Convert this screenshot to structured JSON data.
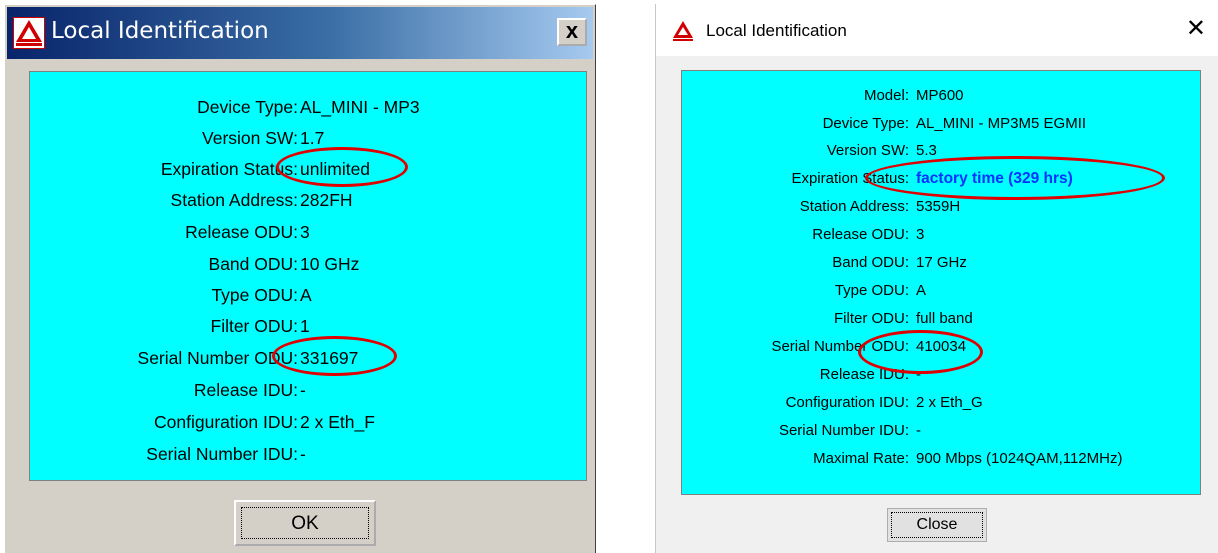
{
  "dialog_classic": {
    "title": "Local Identification",
    "close_glyph": "x",
    "ok_label": "OK",
    "rows": [
      {
        "label": "Device Type:",
        "value": "AL_MINI - MP3"
      },
      {
        "label": "Version SW:",
        "value": "1.7"
      },
      {
        "label": "Expiration Status:",
        "value": "unlimited"
      },
      {
        "label": "Station Address:",
        "value": "282FH"
      },
      {
        "label": "Release ODU:",
        "value": "3"
      },
      {
        "label": "Band ODU:",
        "value": "10 GHz"
      },
      {
        "label": "Type ODU:",
        "value": "A"
      },
      {
        "label": "Filter ODU:",
        "value": "1"
      },
      {
        "label": "Serial Number ODU:",
        "value": "331697"
      },
      {
        "label": "Release IDU:",
        "value": "-"
      },
      {
        "label": "Configuration IDU:",
        "value": "2 x Eth_F"
      },
      {
        "label": "Serial Number IDU:",
        "value": "-"
      }
    ]
  },
  "dialog_modern": {
    "title": "Local Identification",
    "close_glyph": "✕",
    "close_label": "Close",
    "rows": [
      {
        "label": "Model:",
        "value": "MP600"
      },
      {
        "label": "Device Type:",
        "value": "AL_MINI - MP3M5 EGMII"
      },
      {
        "label": "Version SW:",
        "value": "5.3"
      },
      {
        "label": "Expiration Status:",
        "value": "factory time (329 hrs)"
      },
      {
        "label": "Station Address:",
        "value": "5359H"
      },
      {
        "label": "Release ODU:",
        "value": "3"
      },
      {
        "label": "Band ODU:",
        "value": "17 GHz"
      },
      {
        "label": "Type ODU:",
        "value": "A"
      },
      {
        "label": "Filter ODU:",
        "value": "full band"
      },
      {
        "label": "Serial Number ODU:",
        "value": "410034"
      },
      {
        "label": "Release IDU:",
        "value": "-"
      },
      {
        "label": "Configuration IDU:",
        "value": "2 x Eth_G"
      },
      {
        "label": "Serial Number IDU:",
        "value": "-"
      },
      {
        "label": "Maximal Rate:",
        "value": "900 Mbps (1024QAM,112MHz)"
      }
    ]
  },
  "colors": {
    "panel": "#00ffff",
    "highlight_text": "#0033ff",
    "annotation": "#e00000"
  }
}
